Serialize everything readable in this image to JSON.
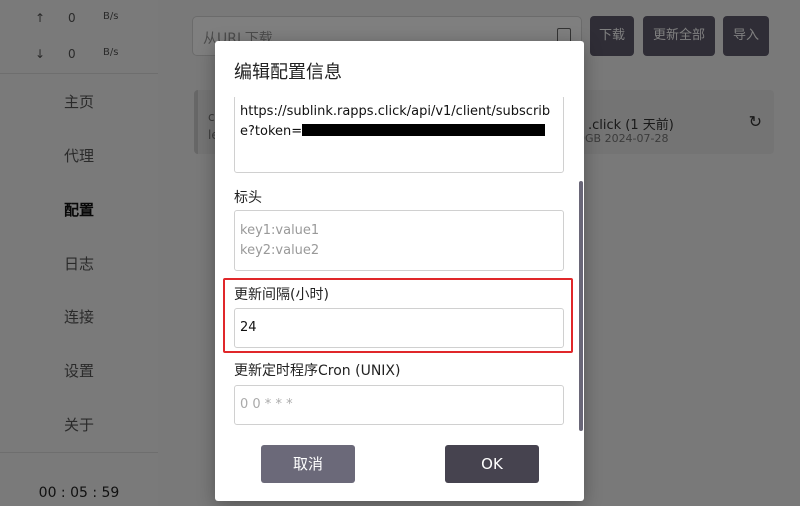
{
  "sidebar": {
    "upload_arrow": "↑",
    "upload_value": "0",
    "upload_unit": "B/s",
    "download_arrow": "↓",
    "download_value": "0",
    "download_unit": "B/s",
    "nav": [
      "主页",
      "代理",
      "配置",
      "日志",
      "连接",
      "设置",
      "关于"
    ],
    "active_nav": "配置",
    "clock": "00 : 05 : 59"
  },
  "toolbar": {
    "url_placeholder": "从URL下载",
    "download_label": "下载",
    "update_all_label": "更新全部",
    "import_label": "导入"
  },
  "profile_card": {
    "left_line1": "c",
    "left_line2": "le",
    "name_partial": ".click (1 天前)",
    "meta_partial": "0GB   2024-07-28"
  },
  "dialog": {
    "title": "编辑配置信息",
    "url_text": "https://sublink.rapps.click/api/v1/client/subscribe?token=",
    "headers_label": "标头",
    "headers_placeholder_line1": "key1:value1",
    "headers_placeholder_line2": "key2:value2",
    "interval_label": "更新间隔(小时)",
    "interval_value": "24",
    "cron_label": "更新定时程序Cron (UNIX)",
    "cron_placeholder": "0 0 * * *",
    "cancel_label": "取消",
    "ok_label": "OK"
  }
}
